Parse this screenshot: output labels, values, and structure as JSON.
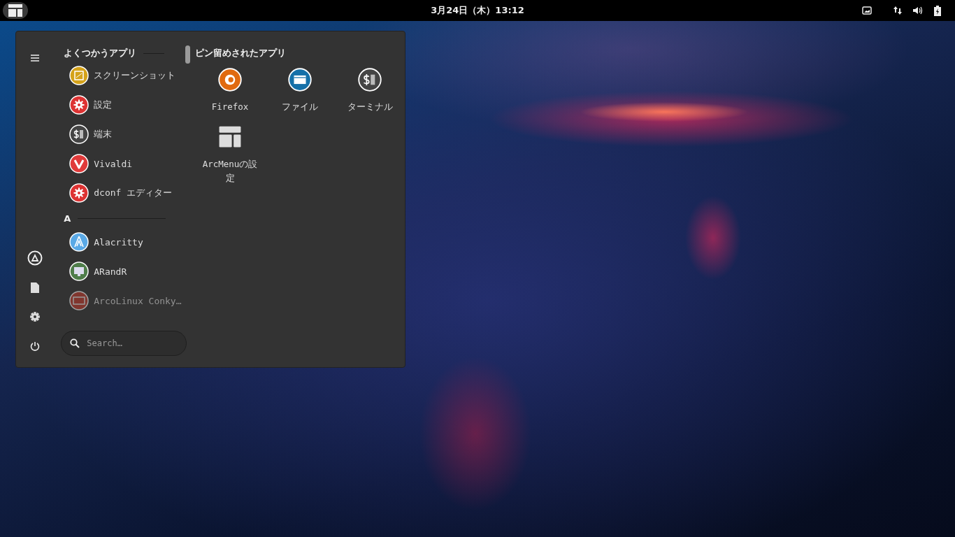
{
  "top_bar": {
    "clock": "3月24日（木）13:12"
  },
  "menu": {
    "frequent_title": "よくつかうアプリ",
    "frequent_apps": [
      {
        "label": "スクリーンショット",
        "kind": "screenshot",
        "dimmed": false
      },
      {
        "label": "設定",
        "kind": "settings",
        "dimmed": false
      },
      {
        "label": "端末",
        "kind": "terminal",
        "dimmed": false
      },
      {
        "label": "Vivaldi",
        "kind": "vivaldi",
        "dimmed": false
      },
      {
        "label": "dconf エディター",
        "kind": "settings",
        "dimmed": false
      }
    ],
    "section_letter": "A",
    "letter_apps": [
      {
        "label": "Alacritty",
        "kind": "alacritty",
        "dimmed": false
      },
      {
        "label": "ARandR",
        "kind": "arandr",
        "dimmed": false
      },
      {
        "label": "ArcoLinux Conky…",
        "kind": "conky",
        "dimmed": true
      }
    ],
    "search": {
      "placeholder": "Search…"
    },
    "pinned_title": "ピン留めされたアプリ",
    "pinned_apps": [
      {
        "label": "Firefox",
        "kind": "firefox"
      },
      {
        "label": "ファイル",
        "kind": "files"
      },
      {
        "label": "ターミナル",
        "kind": "terminal"
      },
      {
        "label": "ArcMenuの設定",
        "kind": "arcmenu"
      }
    ]
  }
}
